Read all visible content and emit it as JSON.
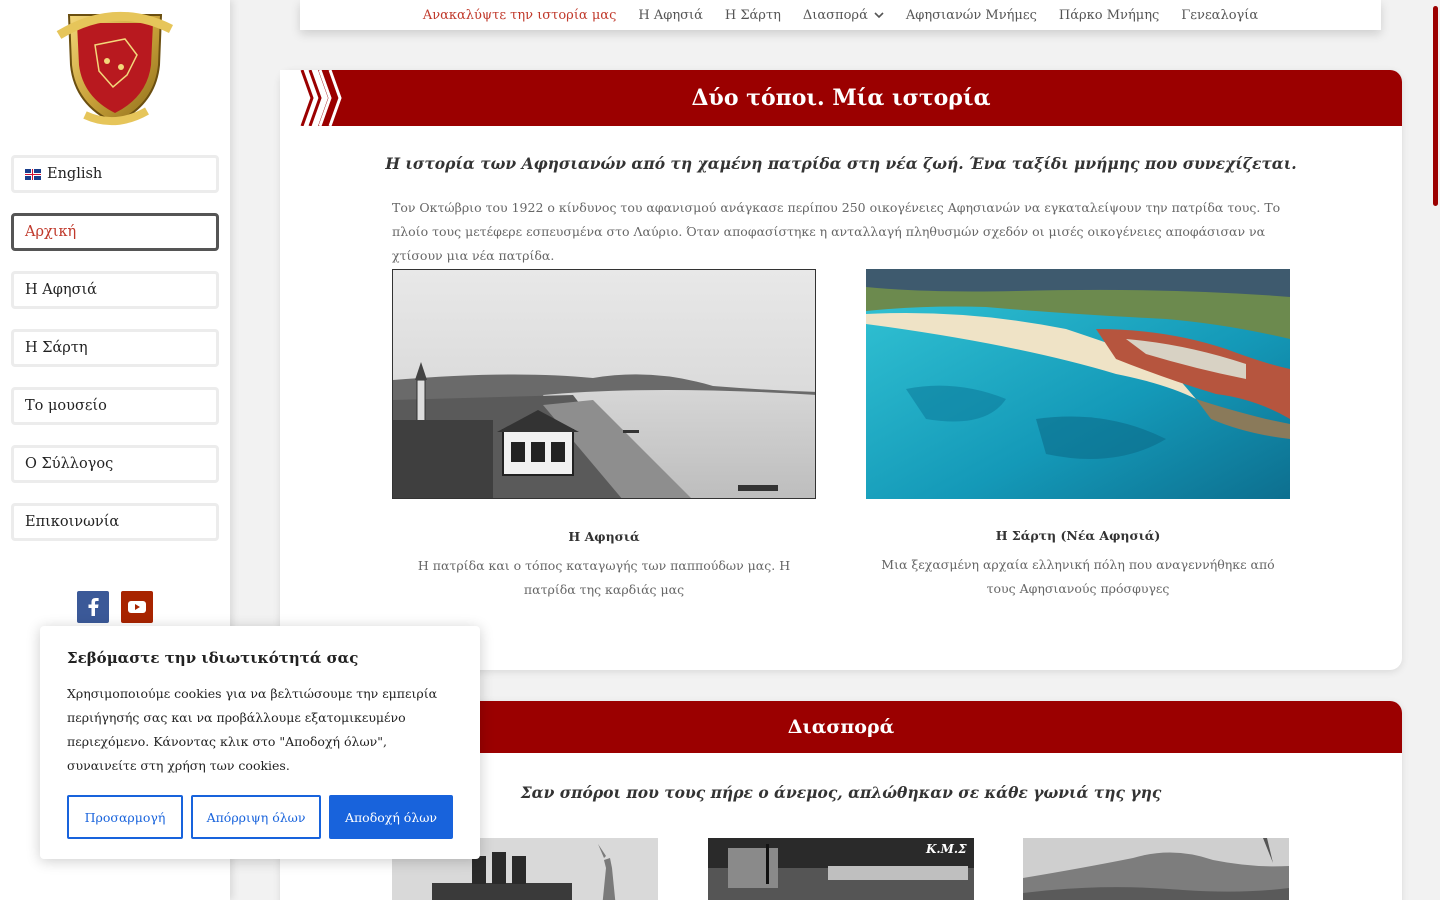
{
  "sidebar": {
    "language_label": "English",
    "items": [
      {
        "label": "Αρχική",
        "active": true
      },
      {
        "label": "Η Αφησιά",
        "active": false
      },
      {
        "label": "Η Σάρτη",
        "active": false
      },
      {
        "label": "Το μουσείο",
        "active": false
      },
      {
        "label": "Ο Σύλλογος",
        "active": false
      },
      {
        "label": "Επικοινωνία",
        "active": false
      }
    ],
    "social": [
      "facebook-icon",
      "youtube-icon"
    ]
  },
  "topnav": {
    "items": [
      {
        "label": "Ανακαλύψτε την ιστορία μας",
        "current": true
      },
      {
        "label": "Η Αφησιά"
      },
      {
        "label": "Η Σάρτη"
      },
      {
        "label": "Διασπορά",
        "has_dropdown": true
      },
      {
        "label": "Αφησιανών Μνήμες"
      },
      {
        "label": "Πάρκο Μνήμης"
      },
      {
        "label": "Γενεαλογία"
      }
    ]
  },
  "section1": {
    "heading": "Δύο τόποι. Μία ιστορία",
    "subtitle": "Η ιστορία των Αφησιανών από τη χαμένη πατρίδα στη νέα ζωή. Ένα ταξίδι μνήμης που συνεχίζεται.",
    "intro": "Τον Οκτώβριο του 1922 ο κίνδυνος του αφανισμού ανάγκασε περίπου 250 οικογένειες Αφησιανών να εγκαταλείψουν την πατρίδα τους. Το πλοίο τους μετέφερε εσπευσμένα στο Λαύριο. Όταν αποφασίστηκε η ανταλλαγή πληθυσμών σχεδόν οι μισές οικογένειες αποφάσισαν να χτίσουν μια νέα πατρίδα.",
    "place1": {
      "title": "Η Αφησιά",
      "text": "Η πατρίδα και ο τόπος καταγωγής των παππούδων μας. Η πατρίδα της καρδιάς μας"
    },
    "place2": {
      "title": "Η Σάρτη (Νέα Αφησιά)",
      "text": "Μια ξεχασμένη αρχαία ελληνική πόλη που αναγεννήθηκε από τους Αφησιανούς πρόσφυγες"
    }
  },
  "section2": {
    "heading": "Διασπορά",
    "subtitle": "Σαν σπόροι που τους πήρε ο άνεμος, απλώθηκαν σε κάθε γωνιά της γης",
    "photo_caption": "Κ.Μ.Σ"
  },
  "cookie": {
    "title": "Σεβόμαστε την ιδιωτικότητά σας",
    "text": "Χρησιμοποιούμε cookies για να βελτιώσουμε την εμπειρία περιήγησής σας και να προβάλλουμε εξατομικευμένο περιεχόμενο. Κάνοντας κλικ στο \"Αποδοχή όλων\", συναινείτε στη χρήση των cookies.",
    "customize_label": "Προσαρμογή",
    "reject_label": "Απόρριψη όλων",
    "accept_label": "Αποδοχή όλων"
  },
  "colors": {
    "brand_red": "#9b0000",
    "link_red": "#c0392b",
    "cookie_blue": "#1863dc",
    "facebook": "#3b5998",
    "youtube": "#a82400"
  }
}
